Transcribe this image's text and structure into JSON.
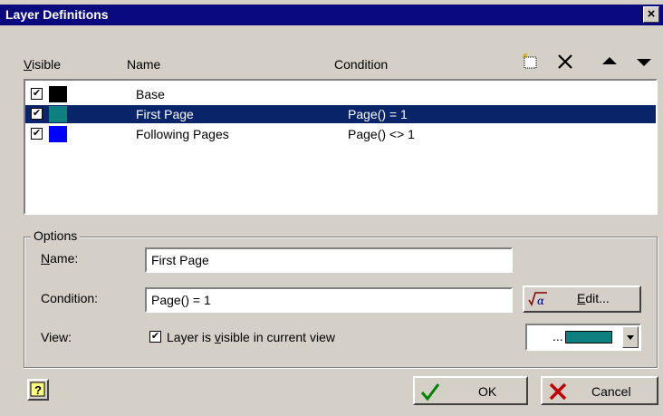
{
  "dialog": {
    "title": "Layer Definitions",
    "close_label": "×"
  },
  "list": {
    "headers": {
      "visible": "Visible",
      "name": "Name",
      "condition": "Condition"
    },
    "rows": [
      {
        "checked": "✔",
        "color": "#000000",
        "name": "Base",
        "condition": "",
        "selected": false
      },
      {
        "checked": "✔",
        "color": "#0e8080",
        "name": "First Page",
        "condition": "Page() = 1",
        "selected": true
      },
      {
        "checked": "✔",
        "color": "#0000ff",
        "name": "Following Pages",
        "condition": "Page() <> 1",
        "selected": false
      }
    ]
  },
  "toolbar": {
    "icons": [
      "new-layer-icon",
      "delete-icon",
      "move-up-icon",
      "move-down-icon"
    ]
  },
  "options": {
    "legend": "Options",
    "name_label": "Name:",
    "name_value": "First Page",
    "condition_label": "Condition:",
    "condition_value": "Page() = 1",
    "edit_label": "Edit...",
    "view_label": "View:",
    "view_checked": "✔",
    "view_checkbox_label": "Layer is visible in current view",
    "color_dots": "...",
    "color": "#0e8080"
  },
  "buttons": {
    "ok": "OK",
    "cancel": "Cancel",
    "help": "?"
  }
}
